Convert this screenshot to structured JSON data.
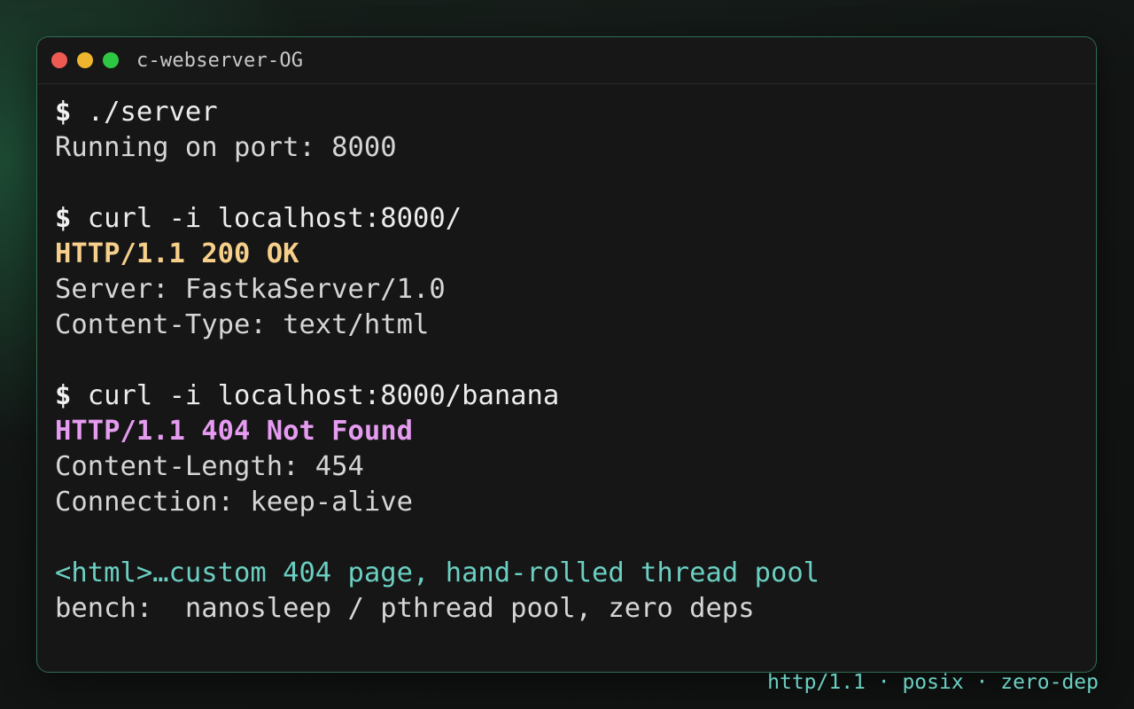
{
  "window": {
    "title": "c-webserver-OG"
  },
  "session": {
    "prompt": "$",
    "cmd1": "./server",
    "out1": "Running on port: 8000",
    "cmd2": "curl -i localhost:8000/",
    "status2": "HTTP/1.1 200 OK",
    "header2a": "Server: FastkaServer/1.0",
    "header2b": "Content-Type: text/html",
    "cmd3": "curl -i localhost:8000/banana",
    "status3": "HTTP/1.1 404 Not Found",
    "header3a": "Content-Length: 454",
    "header3b": "Connection: keep-alive",
    "html_line": "<html>…custom 404 page, hand-rolled thread pool",
    "bench_line": "bench:  nanosleep / pthread pool, zero deps"
  },
  "footer": {
    "tagline": "http/1.1 · posix · zero-dep"
  },
  "colors": {
    "status_ok": "#f6cf8a",
    "status_404": "#e59cf0",
    "accent_teal": "#6bcfc2",
    "border": "#2f6f55"
  }
}
